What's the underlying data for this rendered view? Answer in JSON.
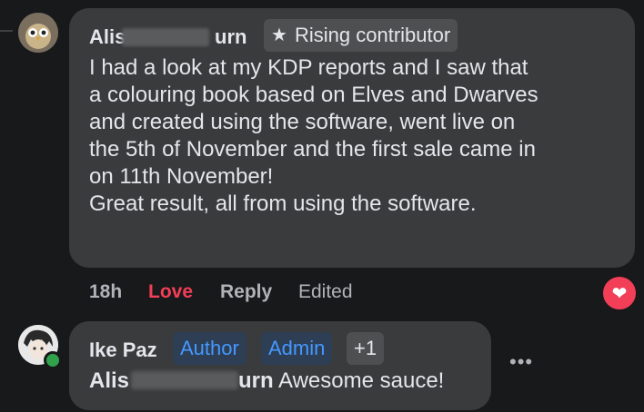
{
  "comment": {
    "author_first": "Alis",
    "author_last_fragment": "urn",
    "badge": "Rising contributor",
    "text": "I had a look at my KDP reports and I saw that\na colouring book based on Elves and Dwarves\nand created using the software, went live on\nthe 5th of November and the first sale came in\non 11th November!\nGreat result, all from using the software.",
    "time": "18h",
    "love_label": "Love",
    "reply_label": "Reply",
    "edited_label": "Edited",
    "reaction_icon": "heart-icon"
  },
  "reply": {
    "author": "Ike Paz",
    "badges": [
      "Author",
      "Admin",
      "+1"
    ],
    "mention_first": "Alis",
    "mention_last_fragment": "urn",
    "text": "Awesome sauce!",
    "more_icon": "more-options-icon"
  },
  "colors": {
    "background": "#18191a",
    "bubble": "#3a3b3c",
    "love": "#f33e58",
    "badge_blue": "#4599ff",
    "online": "#31a24c"
  }
}
